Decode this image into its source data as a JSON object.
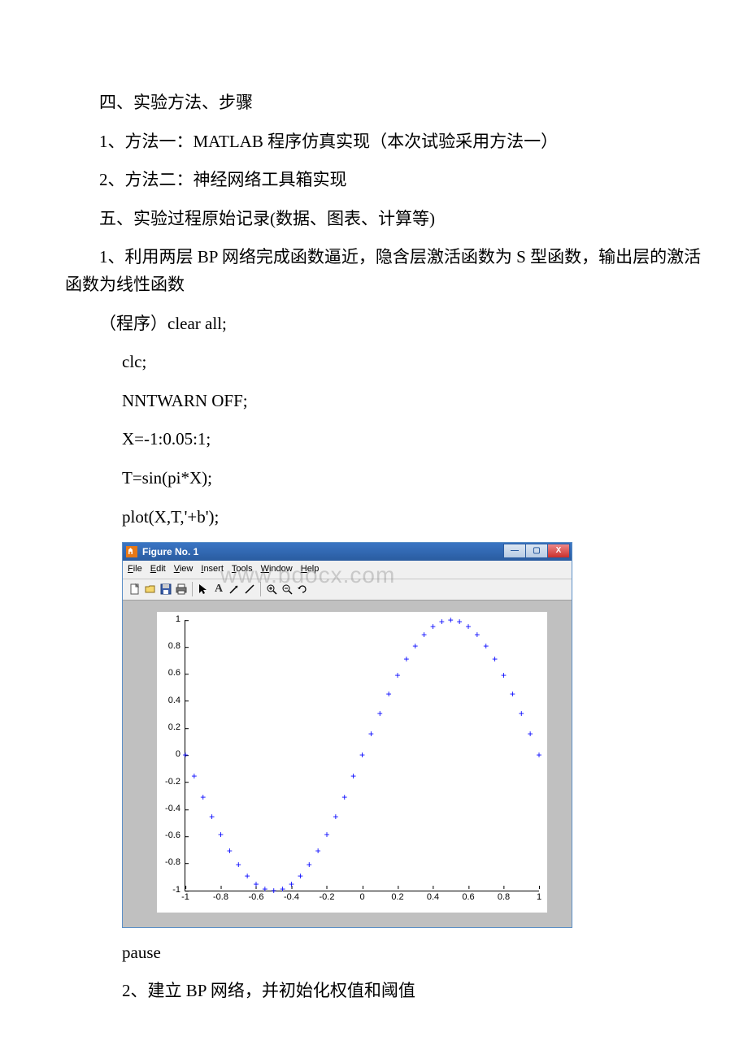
{
  "text": {
    "p1": "四、实验方法、步骤",
    "p2": "1、方法一：MATLAB 程序仿真实现（本次试验采用方法一）",
    "p3": "2、方法二：神经网络工具箱实现",
    "p4": "五、实验过程原始记录(数据、图表、计算等)",
    "p5": "1、利用两层 BP 网络完成函数逼近，隐含层激活函数为 S 型函数，输出层的激活函数为线性函数",
    "p6": "（程序）clear all;",
    "c1": "clc;",
    "c2": "NNTWARN OFF;",
    "c3": "X=-1:0.05:1;",
    "c4": "T=sin(pi*X);",
    "c5": "plot(X,T,'+b');",
    "c6": "pause",
    "p7": "2、建立 BP 网络，并初始化权值和阈值"
  },
  "watermark": "www.bdocx.com",
  "figure": {
    "title": "Figure No. 1",
    "menus": [
      "File",
      "Edit",
      "View",
      "Insert",
      "Tools",
      "Window",
      "Help"
    ],
    "win_buttons": {
      "min": "—",
      "max": "▢",
      "close": "X"
    },
    "toolbar": [
      "new-file-icon",
      "open-icon",
      "save-icon",
      "print-icon",
      "|",
      "pointer-icon",
      "text-a-icon",
      "arrow-icon",
      "line-icon",
      "|",
      "zoom-in-icon",
      "zoom-out-icon",
      "rotate-icon"
    ]
  },
  "chart_data": {
    "type": "scatter",
    "title": "",
    "xlabel": "",
    "ylabel": "",
    "xlim": [
      -1,
      1
    ],
    "ylim": [
      -1,
      1
    ],
    "xticks": [
      -1,
      -0.8,
      -0.6,
      -0.4,
      -0.2,
      0,
      0.2,
      0.4,
      0.6,
      0.8,
      1
    ],
    "yticks": [
      -1,
      -0.8,
      -0.6,
      -0.4,
      -0.2,
      0,
      0.2,
      0.4,
      0.6,
      0.8,
      1
    ],
    "marker": "+",
    "color": "#0000ff",
    "x": [
      -1,
      -0.95,
      -0.9,
      -0.85,
      -0.8,
      -0.75,
      -0.7,
      -0.65,
      -0.6,
      -0.55,
      -0.5,
      -0.45,
      -0.4,
      -0.35,
      -0.3,
      -0.25,
      -0.2,
      -0.15,
      -0.1,
      -0.05,
      0,
      0.05,
      0.1,
      0.15,
      0.2,
      0.25,
      0.3,
      0.35,
      0.4,
      0.45,
      0.5,
      0.55,
      0.6,
      0.65,
      0.7,
      0.75,
      0.8,
      0.85,
      0.9,
      0.95,
      1
    ],
    "y": [
      0,
      -0.1564,
      -0.309,
      -0.454,
      -0.5878,
      -0.7071,
      -0.809,
      -0.891,
      -0.9511,
      -0.9877,
      -1,
      -0.9877,
      -0.9511,
      -0.891,
      -0.809,
      -0.7071,
      -0.5878,
      -0.454,
      -0.309,
      -0.1564,
      0,
      0.1564,
      0.309,
      0.454,
      0.5878,
      0.7071,
      0.809,
      0.891,
      0.9511,
      0.9877,
      1,
      0.9877,
      0.9511,
      0.891,
      0.809,
      0.7071,
      0.5878,
      0.454,
      0.309,
      0.1564,
      0
    ]
  }
}
